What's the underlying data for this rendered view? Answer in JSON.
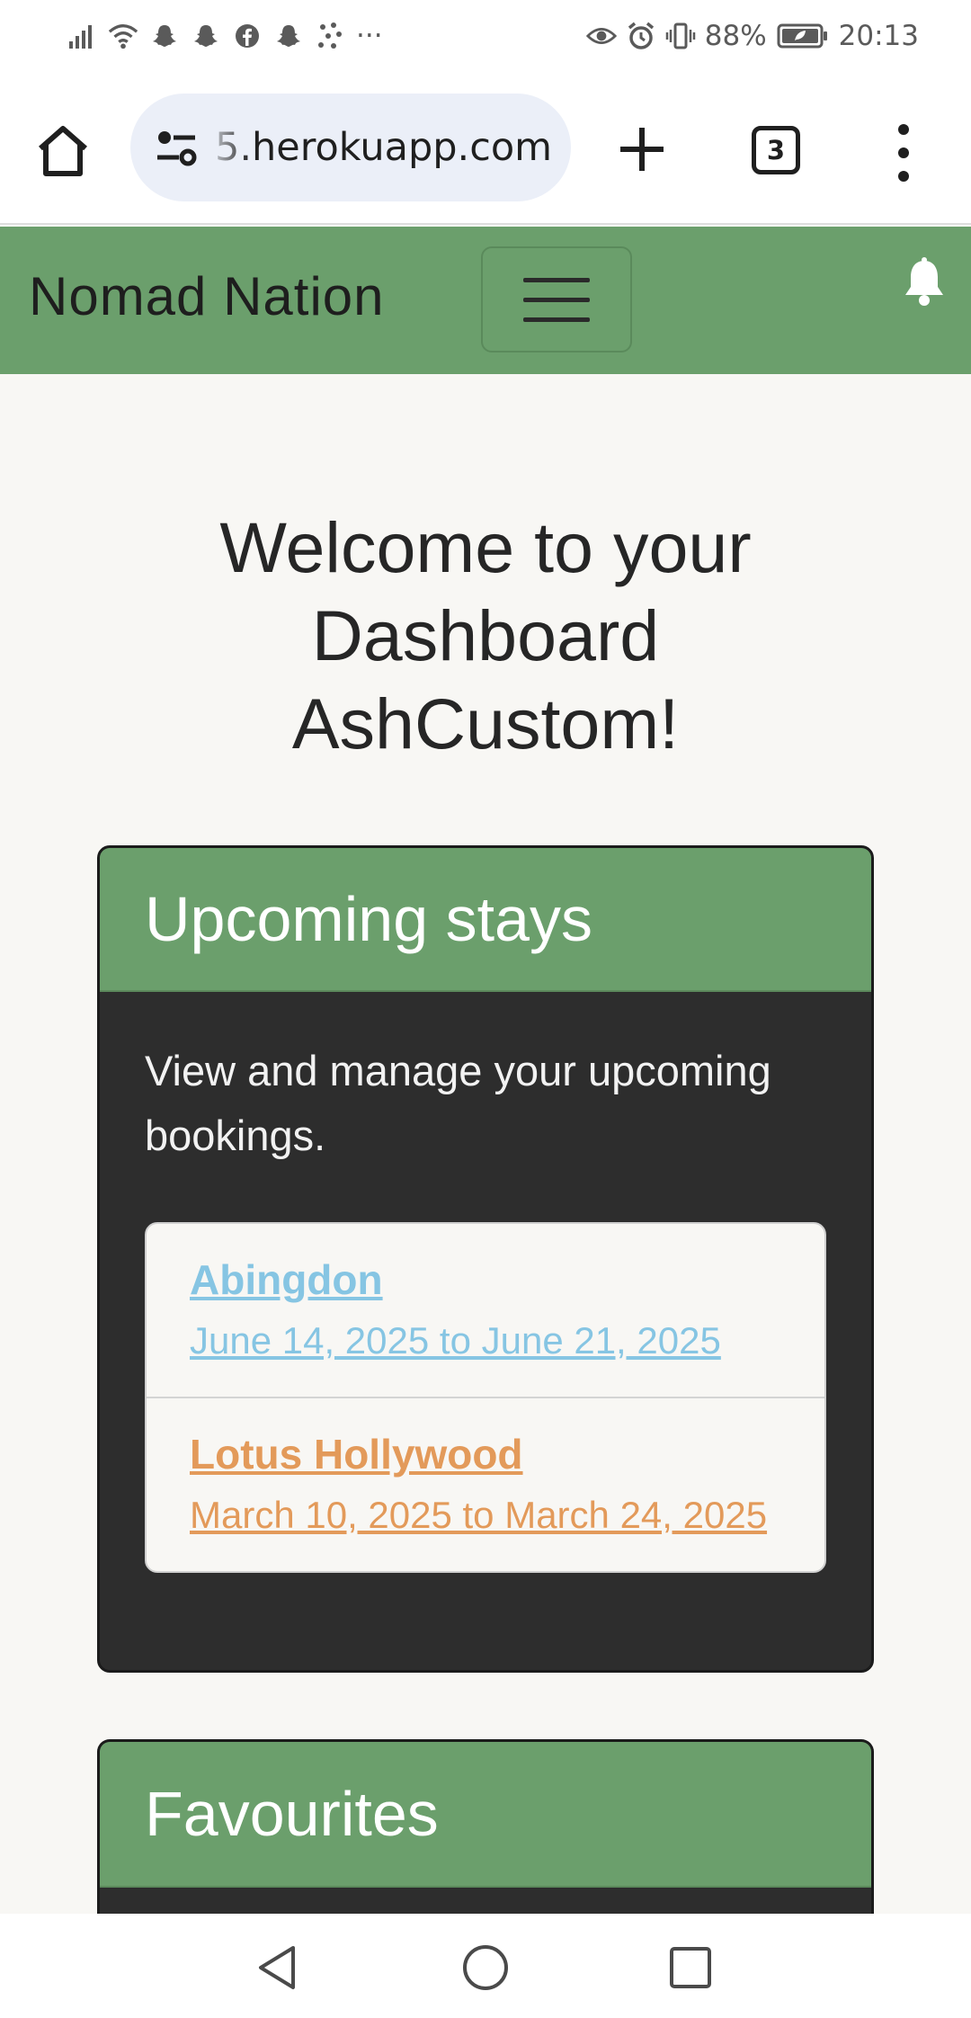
{
  "status_bar": {
    "battery": "88%",
    "time": "20:13",
    "overflow": "···"
  },
  "browser": {
    "url": "5.herokuapp.com",
    "tab_count": "3"
  },
  "navbar": {
    "brand": "Nomad Nation"
  },
  "page": {
    "welcome": "Welcome to your Dashboard AshCustom!"
  },
  "upcoming": {
    "heading": "Upcoming stays",
    "description": "View and manage your upcoming bookings.",
    "bookings": [
      {
        "name": "Abingdon",
        "dates": "June 14, 2025 to June 21, 2025",
        "color": "#86c5e3"
      },
      {
        "name": "Lotus Hollywood",
        "dates": "March 10, 2025 to March 24, 2025",
        "color": "#e39a5a"
      }
    ]
  },
  "favourites": {
    "heading": "Favourites"
  },
  "colors": {
    "nav_green": "#6b9f6c",
    "card_dark": "#2d2d2d",
    "background": "#f8f7f4"
  }
}
